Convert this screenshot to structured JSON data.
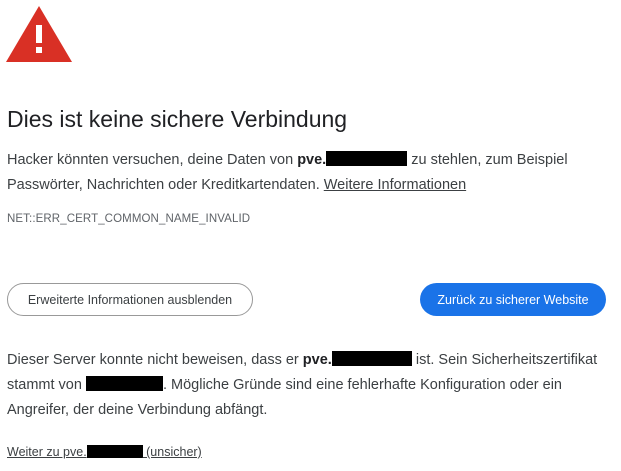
{
  "icon": "warning-triangle-icon",
  "colors": {
    "warning_red": "#d93025",
    "primary_button": "#1a73e8",
    "redaction": "#000000"
  },
  "heading": "Dies ist keine sichere Verbindung",
  "intro": {
    "before_host": "Hacker könnten versuchen, deine Daten von ",
    "host_prefix": "pve.",
    "after_host": " zu stehlen, zum Beispiel Passwörter, Nachrichten oder Kreditkartendaten. ",
    "more_info_link": "Weitere Informationen"
  },
  "error_code": "NET::ERR_CERT_COMMON_NAME_INVALID",
  "buttons": {
    "hide_details": "Erweiterte Informationen ausblenden",
    "back_to_safety": "Zurück zu sicherer Website"
  },
  "details": {
    "part1": "Dieser Server konnte nicht beweisen, dass er ",
    "host_prefix": "pve.",
    "part2": " ist. Sein Sicherheitszertifikat stammt von ",
    "part3": ". Mögliche Gründe sind eine fehlerhafte Konfiguration oder ein Angreifer, der deine Verbindung abfängt."
  },
  "proceed_link": {
    "prefix": "Weiter zu pve.",
    "suffix": " (unsicher)"
  }
}
